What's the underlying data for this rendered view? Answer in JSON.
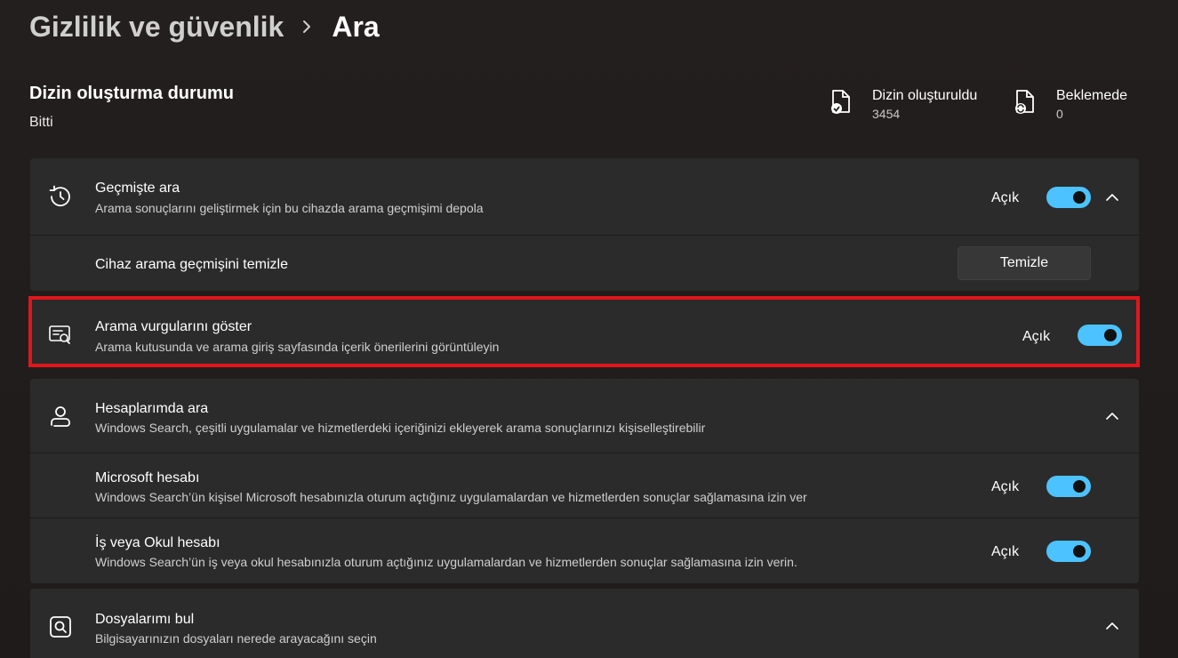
{
  "breadcrumb": {
    "parent": "Gizlilik ve güvenlik",
    "current": "Ara"
  },
  "indexing": {
    "title": "Dizin oluşturma durumu",
    "status": "Bitti",
    "indexed_label": "Dizin oluşturuldu",
    "indexed_value": "3454",
    "pending_label": "Beklemede",
    "pending_value": "0"
  },
  "history": {
    "title": "Geçmişte ara",
    "description": "Arama sonuçlarını geliştirmek için bu cihazda arama geçmişimi depola",
    "state": "Açık",
    "toggle_on": true,
    "clear_label": "Cihaz arama geçmişini temizle",
    "clear_button": "Temizle"
  },
  "highlights": {
    "title": "Arama vurgularını göster",
    "description": "Arama kutusunda ve arama giriş sayfasında içerik önerilerini görüntüleyin",
    "state": "Açık",
    "toggle_on": true
  },
  "accounts": {
    "title": "Hesaplarımda ara",
    "description": "Windows Search, çeşitli uygulamalar ve hizmetlerdeki içeriğinizi ekleyerek arama sonuçlarınızı kişiselleştirebilir",
    "microsoft": {
      "title": "Microsoft hesabı",
      "description": "Windows Search’ün kişisel Microsoft hesabınızla oturum açtığınız uygulamalardan ve hizmetlerden sonuçlar sağlamasına izin ver",
      "state": "Açık",
      "toggle_on": true
    },
    "work": {
      "title": "İş veya Okul hesabı",
      "description": "Windows Search’ün iş veya okul hesabınızla oturum açtığınız uygulamalardan ve hizmetlerden sonuçlar sağlamasına izin verin.",
      "state": "Açık",
      "toggle_on": true
    }
  },
  "find_files": {
    "title": "Dosyalarımı bul",
    "description": "Bilgisayarınızın dosyaları nerede arayacağını seçin"
  },
  "colors": {
    "accent": "#4cc2ff",
    "highlight_border": "#e0161c",
    "card": "#2b2b2b",
    "background": "#201c1c"
  },
  "icons": [
    "chevron-right-icon",
    "document-check-icon",
    "document-sync-icon",
    "history-icon",
    "chevron-up-icon",
    "search-highlights-icon",
    "person-icon",
    "search-box-icon"
  ]
}
